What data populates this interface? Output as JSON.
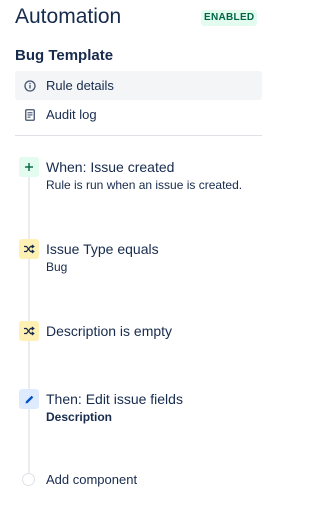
{
  "header": {
    "title": "Automation",
    "status": "ENABLED"
  },
  "rule": {
    "name": "Bug Template"
  },
  "nav": {
    "items": [
      {
        "label": "Rule details",
        "icon": "info-icon",
        "active": true
      },
      {
        "label": "Audit log",
        "icon": "document-icon",
        "active": false
      }
    ]
  },
  "steps": [
    {
      "kind": "trigger",
      "icon": "plus-icon",
      "title": "When: Issue created",
      "subtitle": "Rule is run when an issue is created."
    },
    {
      "kind": "condition",
      "icon": "shuffle-icon",
      "title": "Issue Type equals",
      "subtitle": "Bug"
    },
    {
      "kind": "condition",
      "icon": "shuffle-icon",
      "title": "Description is empty",
      "subtitle": ""
    },
    {
      "kind": "action",
      "icon": "pencil-icon",
      "title": "Then: Edit issue fields",
      "subtitle": "Description"
    }
  ],
  "add_component": {
    "label": "Add component"
  },
  "colors": {
    "trigger": "#e3fcef",
    "condition": "#fff0b3",
    "action": "#deebff",
    "enabled_badge": "#006644"
  }
}
